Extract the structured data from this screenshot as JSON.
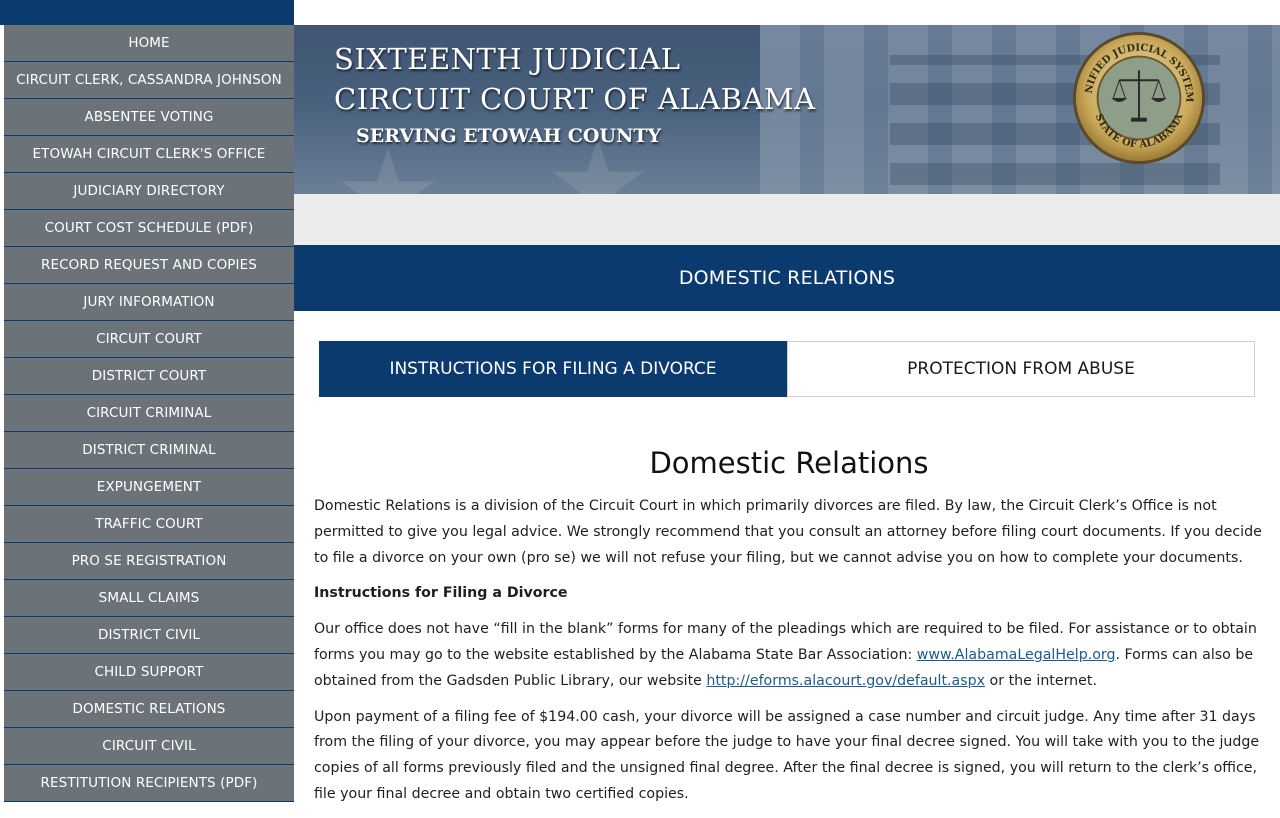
{
  "sidebar": {
    "items": [
      {
        "label": "HOME"
      },
      {
        "label": "CIRCUIT CLERK, CASSANDRA JOHNSON"
      },
      {
        "label": "ABSENTEE VOTING"
      },
      {
        "label": "ETOWAH CIRCUIT CLERK'S OFFICE"
      },
      {
        "label": "JUDICIARY DIRECTORY"
      },
      {
        "label": "COURT COST SCHEDULE (PDF)"
      },
      {
        "label": "RECORD REQUEST AND COPIES"
      },
      {
        "label": "JURY INFORMATION"
      },
      {
        "label": "CIRCUIT COURT"
      },
      {
        "label": "DISTRICT COURT"
      },
      {
        "label": "CIRCUIT CRIMINAL"
      },
      {
        "label": "DISTRICT CRIMINAL"
      },
      {
        "label": "EXPUNGEMENT"
      },
      {
        "label": "TRAFFIC COURT"
      },
      {
        "label": "PRO SE REGISTRATION"
      },
      {
        "label": "SMALL CLAIMS"
      },
      {
        "label": "DISTRICT CIVIL"
      },
      {
        "label": "CHILD SUPPORT"
      },
      {
        "label": "DOMESTIC RELATIONS"
      },
      {
        "label": "CIRCUIT CIVIL"
      },
      {
        "label": "RESTITUTION RECIPIENTS (PDF)"
      }
    ]
  },
  "banner": {
    "line1": "Sixteenth Judicial",
    "line2": "Circuit Court of Alabama",
    "line3": "Serving Etowah County",
    "seal": {
      "top_text": "UNIFIED JUDICIAL SYSTEM",
      "bottom_text": "STATE OF ALABAMA"
    }
  },
  "section_header": "DOMESTIC RELATIONS",
  "tabs": [
    {
      "label": "INSTRUCTIONS FOR FILING A DIVORCE",
      "active": true
    },
    {
      "label": "PROTECTION FROM ABUSE",
      "active": false
    }
  ],
  "content": {
    "heading": "Domestic Relations",
    "intro": "Domestic Relations is a division of the Circuit Court in which primarily divorces are filed. By law, the Circuit Clerk’s Office is not permitted to give you legal advice. We strongly recommend that you consult an attorney before filing court documents. If you decide to file a divorce on your own (pro se) we will not refuse your filing, but we cannot advise you on how to complete your documents.",
    "subheading": "Instructions for Filing a Divorce",
    "para2_a": "Our office does not have “fill in the blank” forms for many of the pleadings which are required to be filed. For assistance or to obtain forms you may go to the website established by the Alabama State Bar Association: ",
    "link1": "www.AlabamaLegalHelp.org",
    "para2_b": ". Forms can also be obtained from the Gadsden Public Library, our website ",
    "link2": "http://eforms.alacourt.gov/default.aspx",
    "para2_c": " or the internet.",
    "para3": "Upon payment of a filing fee of $194.00 cash, your divorce will be assigned a case number and circuit judge. Any time after 31 days from the filing of your divorce, you may appear before the judge to have your final decree signed. You will take with you to the judge copies of all forms previously filed and the unsigned final degree. After the final decree is signed, you will return to the clerk’s office, file your final decree and obtain two certified copies."
  },
  "colors": {
    "navy": "#0b3a6e",
    "sidebar_gray": "#6b7378",
    "link": "#1e5a8e"
  }
}
